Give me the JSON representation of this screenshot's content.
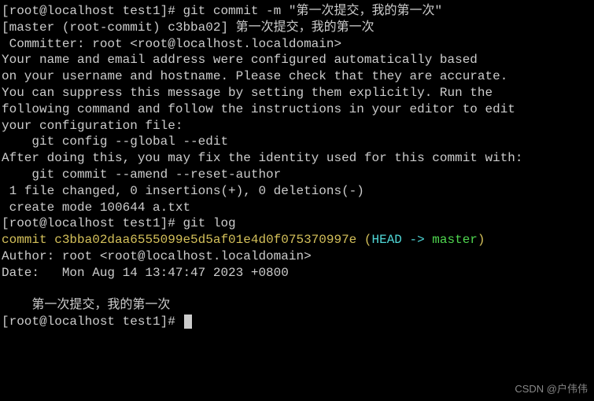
{
  "prompt1": "[root@localhost test1]# ",
  "cmd1": "git commit -m \"第一次提交，我的第一次\"",
  "out1": "[master (root-commit) c3bba02] 第一次提交，我的第一次",
  "out2": " Committer: root <root@localhost.localdomain>",
  "out3": "Your name and email address were configured automatically based",
  "out4": "on your username and hostname. Please check that they are accurate.",
  "out5": "You can suppress this message by setting them explicitly. Run the",
  "out6": "following command and follow the instructions in your editor to edit",
  "out7": "your configuration file:",
  "out8": "",
  "out9": "    git config --global --edit",
  "out10": "",
  "out11": "After doing this, you may fix the identity used for this commit with:",
  "out12": "",
  "out13": "    git commit --amend --reset-author",
  "out14": "",
  "out15": " 1 file changed, 0 insertions(+), 0 deletions(-)",
  "out16": " create mode 100644 a.txt",
  "prompt2": "[root@localhost test1]# ",
  "cmd2": "git log",
  "commit_label": "commit ",
  "commit_hash": "c3bba02daa6555099e5d5af01e4d0f075370997e",
  "head_open": " (",
  "head_label": "HEAD -> ",
  "branch": "master",
  "head_close": ")",
  "author": "Author: root <root@localhost.localdomain>",
  "date": "Date:   Mon Aug 14 13:47:47 2023 +0800",
  "commit_msg": "    第一次提交，我的第一次",
  "prompt3": "[root@localhost test1]# ",
  "watermark": "CSDN @户伟伟"
}
